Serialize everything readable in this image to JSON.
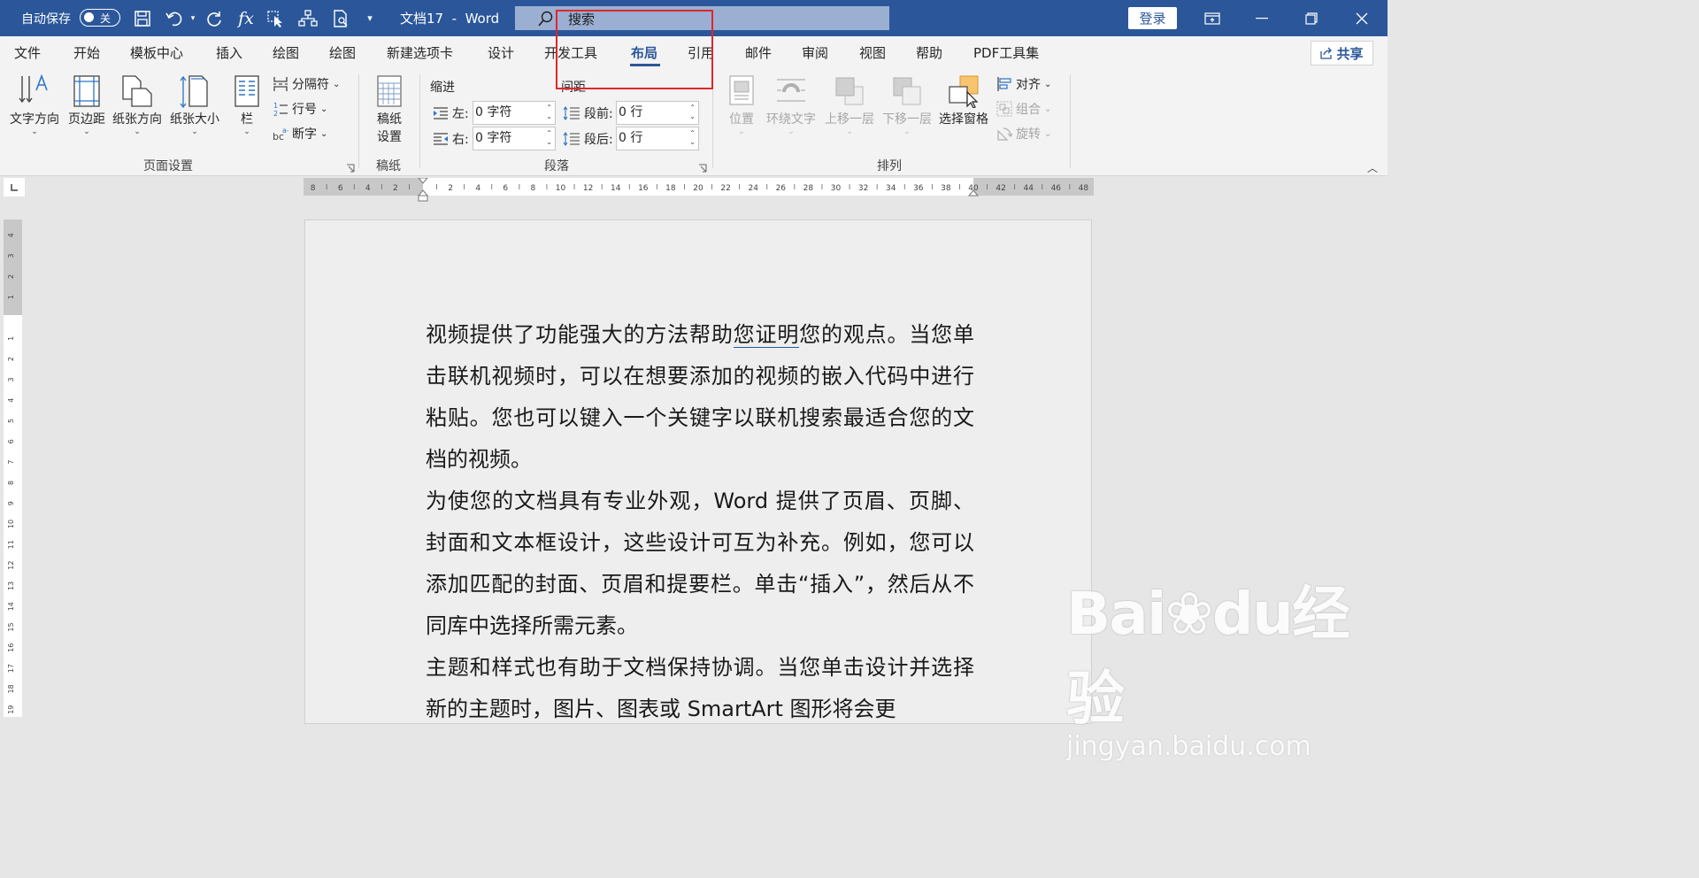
{
  "titlebar": {
    "autosave_label": "自动保存",
    "autosave_state": "关",
    "doc_title": "文档17  -  Word",
    "search_placeholder": "搜索",
    "login": "登录"
  },
  "menu": {
    "tabs": [
      "文件",
      "开始",
      "模板中心",
      "插入",
      "绘图",
      "绘图",
      "新建选项卡",
      "设计",
      "开发工具",
      "布局",
      "引用",
      "邮件",
      "审阅",
      "视图",
      "帮助",
      "PDF工具集"
    ],
    "active_tab": "布局",
    "share": "共享"
  },
  "ribbon": {
    "page_setup": {
      "text_direction": "文字方向",
      "margins": "页边距",
      "orientation": "纸张方向",
      "size": "纸张大小",
      "columns": "栏",
      "breaks": "分隔符",
      "line_numbers": "行号",
      "hyphenation": "断字",
      "group": "页面设置"
    },
    "manuscript": {
      "setup_line1": "稿纸",
      "setup_line2": "设置",
      "group": "稿纸"
    },
    "paragraph": {
      "indent_header": "缩进",
      "spacing_header": "间距",
      "left_label": "左:",
      "left_value": "0 字符",
      "right_label": "右:",
      "right_value": "0 字符",
      "before_label": "段前:",
      "before_value": "0 行",
      "after_label": "段后:",
      "after_value": "0 行",
      "group": "段落"
    },
    "arrange": {
      "position": "位置",
      "wrap_text": "环绕文字",
      "bring_forward": "上移一层",
      "send_backward": "下移一层",
      "selection_pane": "选择窗格",
      "align": "对齐",
      "group_btn": "组合",
      "rotate": "旋转",
      "group": "排列"
    }
  },
  "ruler": {
    "left_numbers": [
      "8",
      "6",
      "4",
      "2"
    ],
    "right_numbers": [
      "2",
      "4",
      "6",
      "8",
      "10",
      "12",
      "14",
      "16",
      "18",
      "20",
      "22",
      "24",
      "26",
      "28",
      "30",
      "32",
      "34",
      "36",
      "38",
      "40",
      "42",
      "44",
      "46",
      "48"
    ],
    "vertical_top": [
      "4",
      "3",
      "2",
      "1"
    ],
    "vertical_numbers": [
      "1",
      "2",
      "3",
      "4",
      "5",
      "6",
      "7",
      "8",
      "9",
      "10",
      "11",
      "12",
      "13",
      "14",
      "15",
      "16",
      "17",
      "18",
      "19"
    ]
  },
  "document": {
    "p1_before": "视频提供了功能强大的方法帮助",
    "p1_underlined": "您证明",
    "p1_after": "您的观点。当您单击联机视频时，可以在想要添加的视频的嵌入代码中进行粘贴。您也可以键入一个关键字以联机搜索最适合您的文档的视频。",
    "p2": "为使您的文档具有专业外观，Word 提供了页眉、页脚、封面和文本框设计，这些设计可互为补充。例如，您可以添加匹配的封面、页眉和提要栏。单击“插入”，然后从不同库中选择所需元素。",
    "p3": "主题和样式也有助于文档保持协调。当您单击设计并选择新的主题时，图片、图表或 SmartArt 图形将会更"
  },
  "watermark": {
    "brand": "Bai",
    "brand2": "du",
    "cn": "经验",
    "url": "jingyan.baidu.com"
  },
  "colors": {
    "titlebar": "#2b579a",
    "highlight_box": "#e0262b"
  }
}
